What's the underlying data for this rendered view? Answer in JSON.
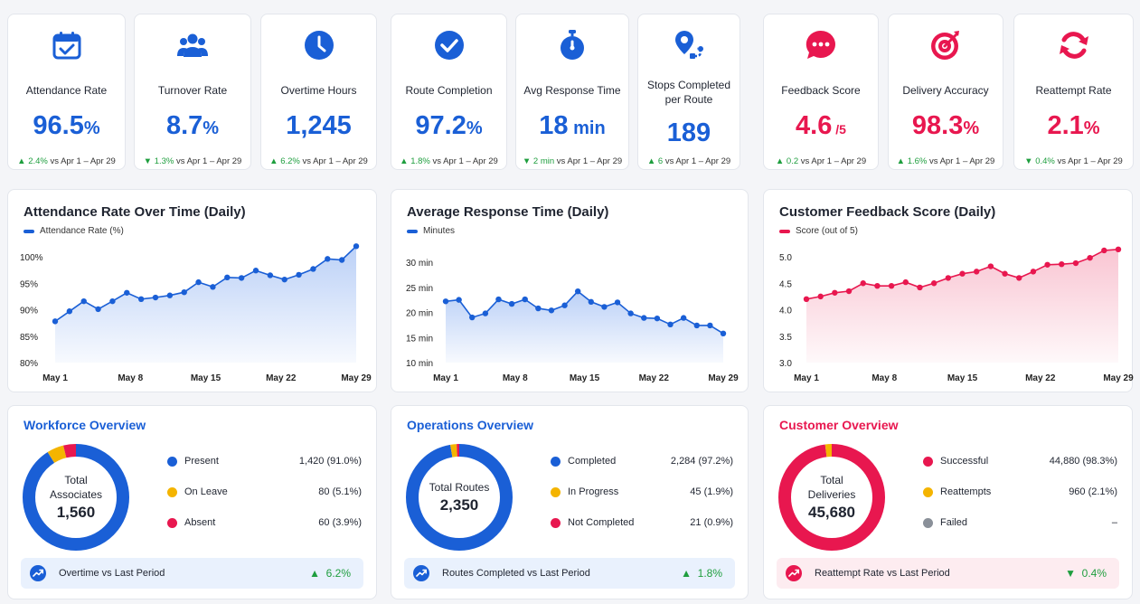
{
  "kpis": [
    {
      "label": "Attendance Rate",
      "value": "96.5",
      "unit": "%",
      "arrow": "▲",
      "delta": "2.4%",
      "period": "vs Apr 1 – Apr 29",
      "icon": "calendar-check-icon",
      "color": "#1a5fd6"
    },
    {
      "label": "Turnover Rate",
      "value": "8.7",
      "unit": "%",
      "arrow": "▼",
      "delta": "1.3%",
      "period": "vs Apr 1 – Apr 29",
      "icon": "people-group-icon",
      "color": "#1a5fd6"
    },
    {
      "label": "Overtime Hours",
      "value": "1,245",
      "unit": "",
      "arrow": "▲",
      "delta": "6.2%",
      "period": "vs Apr 1 – Apr 29",
      "icon": "clock-icon",
      "color": "#1a5fd6"
    },
    {
      "label": "Route Completion",
      "value": "97.2",
      "unit": "%",
      "arrow": "▲",
      "delta": "1.8%",
      "period": "vs Apr 1 – Apr 29",
      "icon": "check-circle-icon",
      "color": "#1a5fd6"
    },
    {
      "label": "Avg Response Time",
      "value": "18",
      "unit": " min",
      "arrow": "▼",
      "delta": "2 min",
      "period": "vs Apr 1 – Apr 29",
      "icon": "stopwatch-icon",
      "color": "#1a5fd6"
    },
    {
      "label": "Stops Completed per Route",
      "value": "189",
      "unit": "",
      "arrow": "▲",
      "delta": "6",
      "period": "vs Apr 1 – Apr 29",
      "icon": "route-pin-icon",
      "color": "#1a5fd6"
    },
    {
      "label": "Feedback Score",
      "value": "4.6",
      "unit": " /5",
      "arrow": "▲",
      "delta": "0.2",
      "period": "vs Apr 1 – Apr 29",
      "icon": "chat-bubble-icon",
      "color": "#e8174f"
    },
    {
      "label": "Delivery Accuracy",
      "value": "98.3",
      "unit": "%",
      "arrow": "▲",
      "delta": "1.6%",
      "period": "vs Apr 1 – Apr 29",
      "icon": "target-icon",
      "color": "#e8174f"
    },
    {
      "label": "Reattempt Rate",
      "value": "2.1",
      "unit": "%",
      "arrow": "▼",
      "delta": "0.4%",
      "period": "vs Apr 1 – Apr 29",
      "icon": "refresh-icon",
      "color": "#e8174f"
    }
  ],
  "charts": [
    {
      "title": "Attendance Rate Over Time (Daily)",
      "legend": "Attendance Rate (%)",
      "color": "#1a5fd6"
    },
    {
      "title": "Average Response Time (Daily)",
      "legend": "Minutes",
      "color": "#1a5fd6"
    },
    {
      "title": "Customer Feedback Score (Daily)",
      "legend": "Score (out of 5)",
      "color": "#e8174f"
    }
  ],
  "chart_data": [
    {
      "type": "area",
      "title": "Attendance Rate Over Time (Daily)",
      "x_ticks": [
        "May 1",
        "May 8",
        "May 15",
        "May 22",
        "May 29"
      ],
      "y_ticks": [
        "80%",
        "85%",
        "90%",
        "95%",
        "100%"
      ],
      "ylim": [
        80,
        100
      ],
      "grid": false,
      "series": [
        {
          "name": "Attendance Rate (%)",
          "values": [
            87.8,
            89.7,
            91.6,
            90.1,
            91.6,
            93.2,
            92.0,
            92.3,
            92.7,
            93.3,
            95.2,
            94.3,
            96.1,
            96.0,
            97.4,
            96.5,
            95.7,
            96.6,
            97.7,
            99.6,
            99.4,
            102.0
          ]
        }
      ]
    },
    {
      "type": "area",
      "title": "Average Response Time (Daily)",
      "x_ticks": [
        "May 1",
        "May 8",
        "May 15",
        "May 22",
        "May 29"
      ],
      "y_ticks": [
        "10 min",
        "15 min",
        "20 min",
        "25 min",
        "30 min"
      ],
      "ylim": [
        10,
        30
      ],
      "grid": false,
      "series": [
        {
          "name": "Minutes",
          "values": [
            22.2,
            22.5,
            19.0,
            19.8,
            22.6,
            21.7,
            22.6,
            20.8,
            20.4,
            21.4,
            24.2,
            22.1,
            21.1,
            22.0,
            19.8,
            18.9,
            18.8,
            17.6,
            18.9,
            17.4,
            17.4,
            15.8
          ]
        }
      ]
    },
    {
      "type": "area",
      "title": "Customer Feedback Score (Daily)",
      "x_ticks": [
        "May 1",
        "May 8",
        "May 15",
        "May 22",
        "May 29"
      ],
      "y_ticks": [
        "3.0",
        "3.5",
        "4.0",
        "4.5",
        "5.0"
      ],
      "ylim": [
        3.0,
        5.0
      ],
      "grid": false,
      "series": [
        {
          "name": "Score (out of 5)",
          "values": [
            4.2,
            4.25,
            4.32,
            4.35,
            4.5,
            4.45,
            4.45,
            4.52,
            4.42,
            4.5,
            4.6,
            4.68,
            4.72,
            4.82,
            4.68,
            4.6,
            4.72,
            4.85,
            4.86,
            4.88,
            4.98,
            5.12,
            5.14
          ]
        }
      ]
    }
  ],
  "overviews": [
    {
      "title": "Workforce Overview",
      "title_color": "#1a5fd6",
      "center_label": "Total Associates",
      "center_value": "1,560",
      "rows": [
        {
          "name": "Present",
          "value": "1,420 (91.0%)",
          "color": "#1a5fd6",
          "share": 91.0
        },
        {
          "name": "On Leave",
          "value": "80 (5.1%)",
          "color": "#f4b400",
          "share": 5.1
        },
        {
          "name": "Absent",
          "value": "60 (3.9%)",
          "color": "#e8174f",
          "share": 3.9
        }
      ],
      "footer_label": "Overtime vs Last Period",
      "footer_arrow": "▲",
      "footer_value": "6.2%",
      "footer_bg": "#e9f1fd",
      "footer_icon": "trend-up-icon",
      "footer_icon_color": "#1a5fd6"
    },
    {
      "title": "Operations Overview",
      "title_color": "#1a5fd6",
      "center_label": "Total Routes",
      "center_value": "2,350",
      "rows": [
        {
          "name": "Completed",
          "value": "2,284 (97.2%)",
          "color": "#1a5fd6",
          "share": 97.2
        },
        {
          "name": "In Progress",
          "value": "45 (1.9%)",
          "color": "#f4b400",
          "share": 1.9
        },
        {
          "name": "Not Completed",
          "value": "21 (0.9%)",
          "color": "#e8174f",
          "share": 0.9
        }
      ],
      "footer_label": "Routes Completed vs Last Period",
      "footer_arrow": "▲",
      "footer_value": "1.8%",
      "footer_bg": "#e9f1fd",
      "footer_icon": "trend-up-icon",
      "footer_icon_color": "#1a5fd6"
    },
    {
      "title": "Customer Overview",
      "title_color": "#e8174f",
      "center_label": "Total Deliveries",
      "center_value": "45,680",
      "rows": [
        {
          "name": "Successful",
          "value": "44,880 (98.3%)",
          "color": "#e8174f",
          "share": 98.3
        },
        {
          "name": "Reattempts",
          "value": "960 (2.1%)",
          "color": "#f4b400",
          "share": 2.1
        },
        {
          "name": "Failed",
          "value": "–",
          "color": "#8a9099",
          "share": 0
        }
      ],
      "footer_label": "Reattempt Rate vs Last Period",
      "footer_arrow": "▼",
      "footer_value": "0.4%",
      "footer_bg": "#fdecf0",
      "footer_icon": "trend-up-icon",
      "footer_icon_color": "#e8174f"
    }
  ]
}
